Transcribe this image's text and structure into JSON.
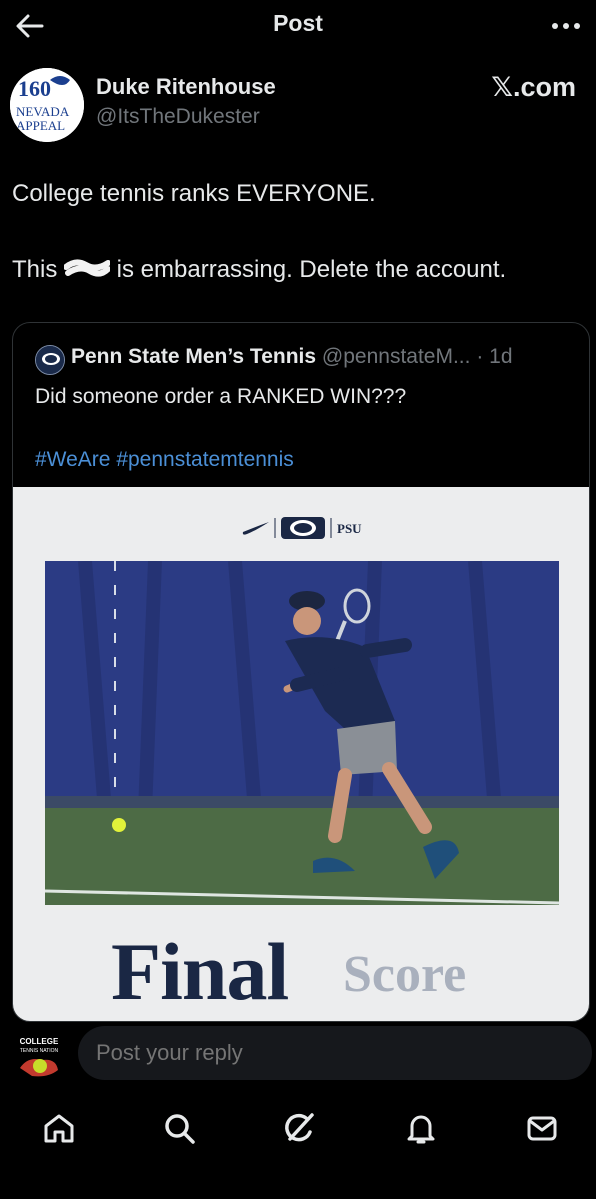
{
  "header": {
    "title": "Post",
    "back_icon": "arrow-left-icon",
    "more_icon": "more-dots-icon"
  },
  "post": {
    "author_name": "Duke Ritenhouse",
    "author_handle": "@ItsTheDukester",
    "avatar_logo_text": [
      "160",
      "NEVADA",
      "APPEAL"
    ],
    "source": "𝕏.com",
    "text_line1": "College tennis ranks EVERYONE.",
    "text_line2_before": "This ",
    "text_line2_after": " is embarrassing. Delete the account."
  },
  "quote": {
    "name": "Penn State Men’s Tennis",
    "handle": "@pennstateM...",
    "separator": "·",
    "time": "1d",
    "text": "Did someone order a RANKED WIN???",
    "hashtags": "#WeAre #pennstatemtennis",
    "media": {
      "brand_text": "PSU",
      "headline_1": "Final",
      "headline_2": "Score"
    }
  },
  "reply": {
    "placeholder": "Post your reply",
    "avatar_logo_text": [
      "COLLEGE",
      "TENNIS NATION"
    ]
  },
  "nav": {
    "items": [
      "home-icon",
      "search-icon",
      "grok-icon",
      "notifications-icon",
      "messages-icon"
    ]
  },
  "colors": {
    "background": "#000000",
    "text": "#e7e9ea",
    "secondary": "#71767b",
    "link": "#4b8fd6",
    "border": "#2f3336"
  }
}
